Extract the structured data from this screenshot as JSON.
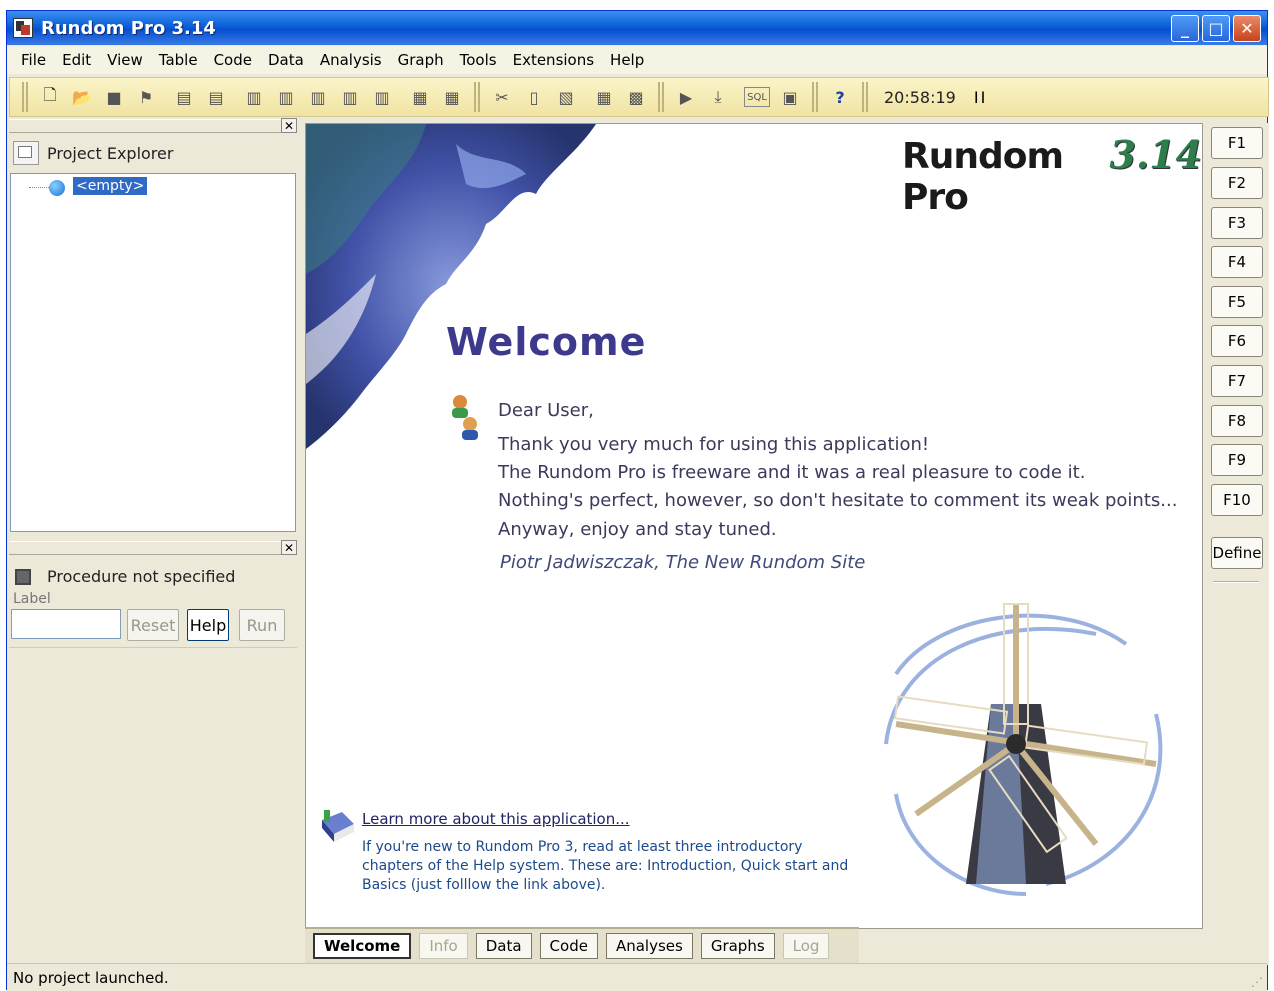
{
  "window": {
    "title": "Rundom Pro 3.14"
  },
  "menu": [
    "File",
    "Edit",
    "View",
    "Table",
    "Code",
    "Data",
    "Analysis",
    "Graph",
    "Tools",
    "Extensions",
    "Help"
  ],
  "toolbar": {
    "clock": "20:58:19",
    "pause_label": "II",
    "sql_label": "SQL",
    "help_label": "?"
  },
  "explorer": {
    "title": "Project Explorer",
    "tree_item": "<empty>"
  },
  "procedure": {
    "status": "Procedure not specified",
    "label_caption": "Label",
    "label_value": "",
    "reset_label": "Reset",
    "help_label": "Help",
    "run_label": "Run"
  },
  "content": {
    "brand_name": "Rundom Pro",
    "brand_version": "3.14",
    "welcome": "Welcome",
    "greeting": "Dear User,",
    "lines": [
      "Thank you very much for using this application!",
      "The Rundom Pro is freeware and it was a real pleasure to code it.",
      "Nothing's perfect, however, so don't hesitate to comment its weak points...",
      "Anyway, enjoy and stay tuned."
    ],
    "signature": "Piotr Jadwiszczak, The New Rundom Site",
    "learn_link": "Learn more about this application...",
    "help_note": "If you're new to Rundom Pro 3, read at least three introductory chapters of the Help system. These are: Introduction, Quick start and Basics (just folllow the link above)."
  },
  "tabs": [
    {
      "label": "Welcome",
      "state": "selected"
    },
    {
      "label": "Info",
      "state": "disabled"
    },
    {
      "label": "Data",
      "state": "normal"
    },
    {
      "label": "Code",
      "state": "normal"
    },
    {
      "label": "Analyses",
      "state": "normal"
    },
    {
      "label": "Graphs",
      "state": "normal"
    },
    {
      "label": "Log",
      "state": "disabled"
    }
  ],
  "fkeys": [
    "F1",
    "F2",
    "F3",
    "F4",
    "F5",
    "F6",
    "F7",
    "F8",
    "F9",
    "F10"
  ],
  "define_label": "Define",
  "status": {
    "text": "No project launched."
  },
  "colors": {
    "titlebar": "#0a5fd8",
    "welcome": "#3d3a8e",
    "version": "#2e7d4d",
    "selection": "#316ac5"
  }
}
